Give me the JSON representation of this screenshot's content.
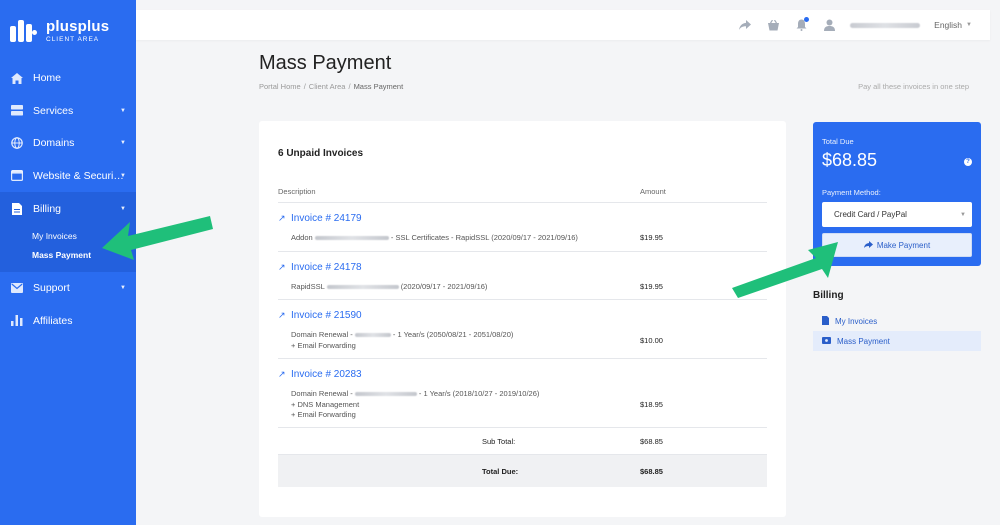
{
  "brand": {
    "name": "plusplus",
    "subtitle": "CLIENT AREA"
  },
  "sidebar": {
    "items": [
      {
        "label": "Home",
        "icon": "home-icon",
        "has_caret": false
      },
      {
        "label": "Services",
        "icon": "server-icon",
        "has_caret": true
      },
      {
        "label": "Domains",
        "icon": "globe-icon",
        "has_caret": true
      },
      {
        "label": "Website & Securi…",
        "icon": "window-icon",
        "has_caret": true
      },
      {
        "label": "Billing",
        "icon": "document-icon",
        "has_caret": true
      },
      {
        "label": "Support",
        "icon": "envelope-icon",
        "has_caret": true
      },
      {
        "label": "Affiliates",
        "icon": "bar-chart-icon",
        "has_caret": false
      }
    ],
    "billing_sub": [
      "My Invoices",
      "Mass Payment"
    ]
  },
  "topbar": {
    "language": "English"
  },
  "page": {
    "title": "Mass Payment",
    "breadcrumb": [
      "Portal Home",
      "Client Area",
      "Mass Payment"
    ],
    "tagline": "Pay all these invoices in one step"
  },
  "invoices_card": {
    "title": "6 Unpaid Invoices",
    "col_description": "Description",
    "col_amount": "Amount",
    "invoices": [
      {
        "number": "Invoice # 24179",
        "lines": [
          {
            "pre": "Addon",
            "post": "- SSL Certificates - RapidSSL (2020/09/17 - 2021/09/16)"
          }
        ],
        "amount": "$19.95"
      },
      {
        "number": "Invoice # 24178",
        "lines": [
          {
            "pre": "RapidSSL",
            "post": "(2020/09/17 - 2021/09/16)"
          }
        ],
        "amount": "$19.95"
      },
      {
        "number": "Invoice # 21590",
        "lines": [
          {
            "pre": "Domain Renewal -",
            "post": "- 1 Year/s (2050/08/21 - 2051/08/20)"
          },
          {
            "pre": "+ Email Forwarding",
            "post": ""
          }
        ],
        "amount": "$10.00"
      },
      {
        "number": "Invoice # 20283",
        "lines": [
          {
            "pre": "Domain Renewal -",
            "post": "- 1 Year/s (2018/10/27 - 2019/10/26)"
          },
          {
            "pre": "+ DNS Management",
            "post": ""
          },
          {
            "pre": "+ Email Forwarding",
            "post": ""
          }
        ],
        "amount": "$18.95"
      }
    ],
    "subtotal_label": "Sub Total:",
    "subtotal_value": "$68.85",
    "total_label": "Total Due:",
    "total_value": "$68.85"
  },
  "due_panel": {
    "total_label": "Total Due",
    "total_amount": "$68.85",
    "payment_method_label": "Payment Method:",
    "payment_method_value": "Credit Card / PayPal",
    "pay_button": "Make Payment"
  },
  "side_menu": {
    "title": "Billing",
    "items": [
      "My Invoices",
      "Mass Payment"
    ]
  },
  "colors": {
    "primary": "#2a6cf0",
    "arrow": "#1fbf7a"
  }
}
